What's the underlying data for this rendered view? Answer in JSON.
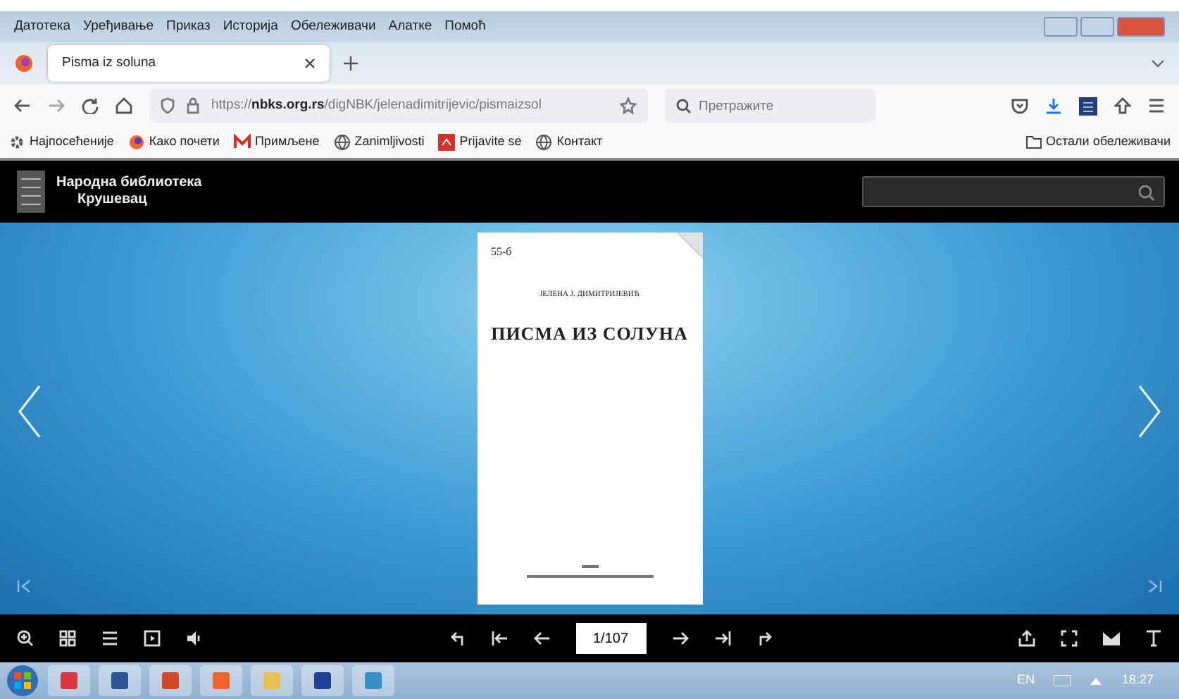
{
  "menu": [
    "Датотека",
    "Уређивање",
    "Приказ",
    "Историја",
    "Обележивачи",
    "Алатке",
    "Помоћ"
  ],
  "tabs": [
    {
      "title": "Pisma iz soluna",
      "selected": true
    }
  ],
  "address": {
    "url": "https://**nbks.org.rs**/digNBK/jelenadimitrijevic/pismaizsol"
  },
  "search": {
    "placeholder": "Претражите"
  },
  "bookmarks": [
    {
      "label": "Најпосећеније",
      "kind": "gear"
    },
    {
      "label": "Како почети",
      "kind": "browser"
    },
    {
      "label": "Примљене",
      "kind": "mail"
    },
    {
      "label": "Zanimljivosti",
      "kind": "globe"
    },
    {
      "label": "Prijavite se",
      "kind": "app"
    },
    {
      "label": "Контакт",
      "kind": "globe"
    }
  ],
  "other_bookmarks": "Остали обележивачи",
  "site": {
    "title_lines": [
      "Народна библиотека",
      "Крушевац"
    ]
  },
  "book_page": {
    "mark": "55-б",
    "author": "ЈЕЛЕНА Ј. ДИМИТРИЈЕВИЋ",
    "title": "ПИСМА ИЗ СОЛУНА"
  },
  "pager": {
    "value": "1/107"
  },
  "taskbar": {
    "language": "EN",
    "clock": "18:27"
  }
}
